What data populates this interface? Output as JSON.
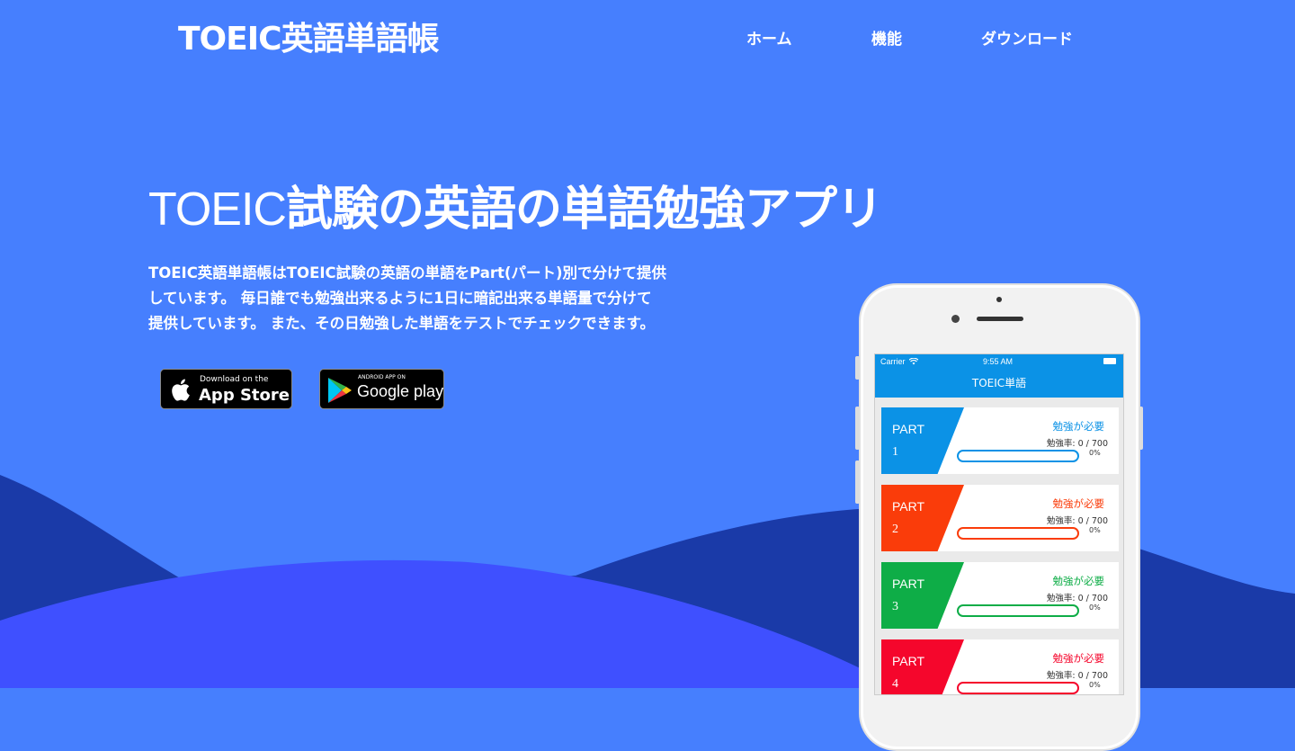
{
  "header": {
    "brand": "TOEIC英語単語帳",
    "nav": [
      {
        "label": "ホーム"
      },
      {
        "label": "機能"
      },
      {
        "label": "ダウンロード"
      }
    ]
  },
  "hero": {
    "title_latin": "TOEIC",
    "title_jp": "試験の英語の単語勉強アプリ",
    "description_lines": [
      "TOEIC英語単語帳はTOEIC試験の英語の単語をPart(パート)別で分けて提供",
      "しています。 毎日誰でも勉強出来るように1日に暗記出来る単語量で分けて",
      "提供しています。 また、その日勉強した単語をテストでチェックできます。"
    ]
  },
  "stores": {
    "appstore": {
      "small": "Download on the",
      "big": "App Store",
      "icon": "apple-icon"
    },
    "googleplay": {
      "small": "ANDROID APP ON",
      "big": "Google play",
      "icon": "play-icon"
    }
  },
  "phone": {
    "status": {
      "carrier": "Carrier",
      "time": "9:55 AM"
    },
    "nav_title": "TOEIC単語",
    "cards": [
      {
        "part": "PART",
        "num": "1",
        "need": "勉強が必要",
        "rate": "勉強率: 0 / 700",
        "percent": "0%",
        "progress": 0,
        "color": "#0b92e6"
      },
      {
        "part": "PART",
        "num": "2",
        "need": "勉強が必要",
        "rate": "勉強率: 0 / 700",
        "percent": "0%",
        "progress": 0,
        "color": "#fa3c0a"
      },
      {
        "part": "PART",
        "num": "3",
        "need": "勉強が必要",
        "rate": "勉強率: 0 / 700",
        "percent": "0%",
        "progress": 0,
        "color": "#0ead47"
      },
      {
        "part": "PART",
        "num": "4",
        "need": "勉強が必要",
        "rate": "勉強率: 0 / 700",
        "percent": "0%",
        "progress": 0,
        "color": "#f5062c"
      }
    ]
  },
  "colors": {
    "background": "#467ffe",
    "wave_dark": "#1a3aa8",
    "wave_light": "#3f50ff"
  }
}
